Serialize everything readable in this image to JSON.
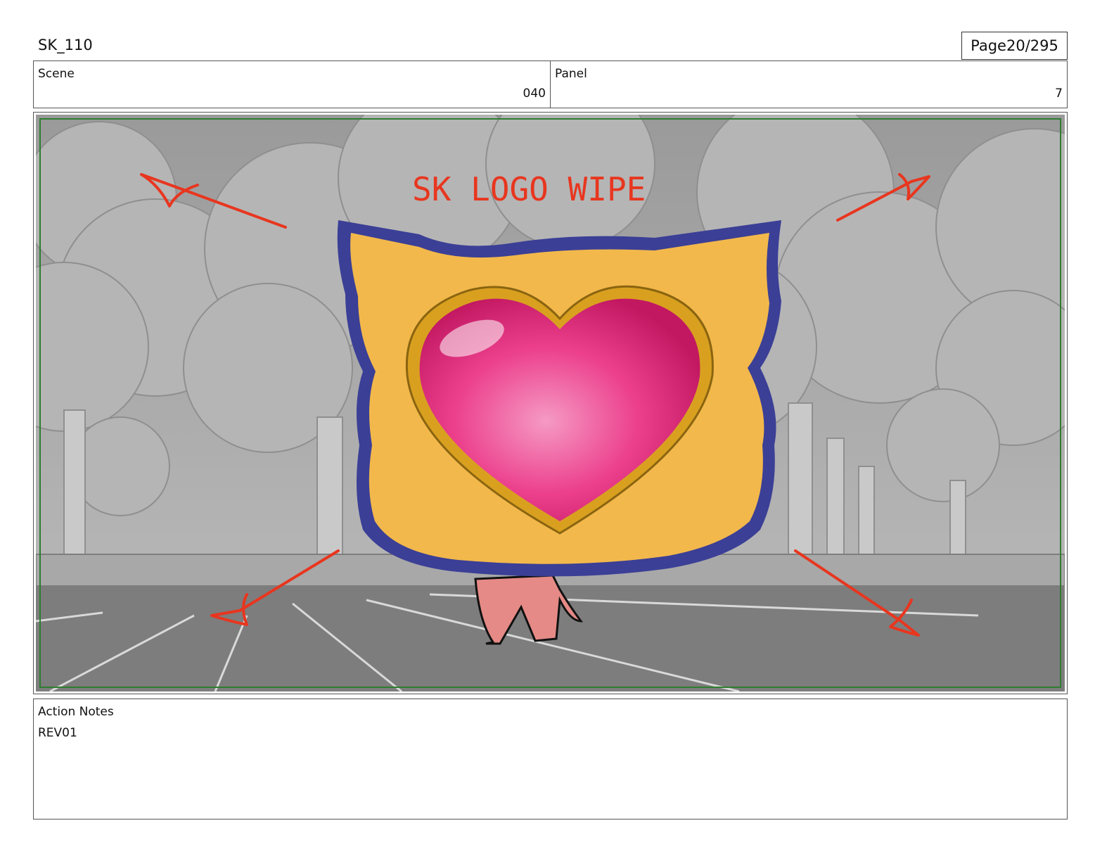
{
  "header": {
    "sheet_code": "SK_110",
    "page_label": "Page",
    "page_number": "20/295"
  },
  "scene": {
    "label": "Scene",
    "value": "040"
  },
  "panel": {
    "label": "Panel",
    "value": "7"
  },
  "artwork": {
    "annotation": "SK LOGO WIPE",
    "colors": {
      "annotation_red": "#e8361f",
      "safe_frame_green": "#2e7d32",
      "logo_gold": "#f2b84b",
      "logo_outline": "#3b3f96",
      "heart_pink": "#ec3f8c",
      "cat_pink": "#e58a86"
    }
  },
  "notes": {
    "label": "Action Notes",
    "text": "REV01"
  }
}
